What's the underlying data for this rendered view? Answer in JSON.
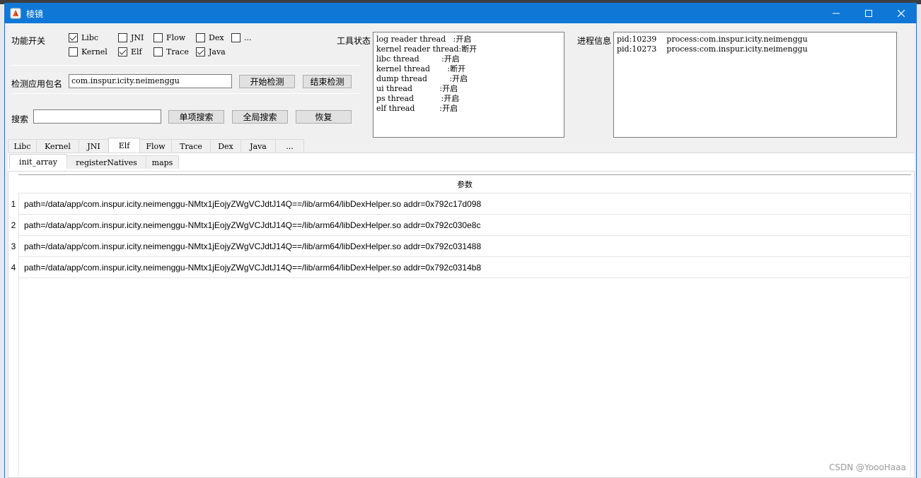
{
  "window": {
    "title": "棱镜",
    "controls": {
      "minimize": "minimize-icon",
      "maximize": "maximize-icon",
      "close": "close-icon"
    },
    "title_bar_color": "#0f78d7"
  },
  "feature_switch": {
    "label": "功能开关",
    "checkboxes": [
      {
        "label": "Libc",
        "checked": true
      },
      {
        "label": "JNI",
        "checked": false
      },
      {
        "label": "Flow",
        "checked": false
      },
      {
        "label": "Dex",
        "checked": false
      },
      {
        "label": "...",
        "checked": false
      },
      {
        "label": "Kernel",
        "checked": false
      },
      {
        "label": "Elf",
        "checked": true
      },
      {
        "label": "Trace",
        "checked": false
      },
      {
        "label": "Java",
        "checked": true
      }
    ]
  },
  "detect": {
    "label": "检测应用包名",
    "package_value": "com.inspur.icity.neimenggu",
    "start_button": "开始检测",
    "stop_button": "结束检测"
  },
  "search": {
    "label": "搜索",
    "value": "",
    "single_button": "单项搜索",
    "global_button": "全局搜索",
    "restore_button": "恢复"
  },
  "tool_status": {
    "label": "工具状态",
    "lines": [
      "log reader thread   :开启",
      "kernel reader thread:断开",
      "libc thread         :开启",
      "kernel thread       :断开",
      "dump thread         :开启",
      "ui thread           :开启",
      "ps thread           :开启",
      "elf thread          :开启"
    ]
  },
  "process_info": {
    "label": "进程信息",
    "lines": [
      "pid:10239    process:com.inspur.icity.neimenggu",
      "pid:10273    process:com.inspur.icity.neimenggu"
    ]
  },
  "main_tabs": {
    "items": [
      "Libc",
      "Kernel",
      "JNI",
      "Elf",
      "Flow",
      "Trace",
      "Dex",
      "Java",
      "..."
    ],
    "active": "Elf"
  },
  "sub_tabs": {
    "items": [
      "init_array",
      "registerNatives",
      "maps"
    ],
    "active": "init_array"
  },
  "table": {
    "column_header": "参数",
    "rows": [
      {
        "num": "1",
        "value": "path=/data/app/com.inspur.icity.neimenggu-NMtx1jEojyZWgVCJdtJ14Q==/lib/arm64/libDexHelper.so addr=0x792c17d098"
      },
      {
        "num": "2",
        "value": "path=/data/app/com.inspur.icity.neimenggu-NMtx1jEojyZWgVCJdtJ14Q==/lib/arm64/libDexHelper.so addr=0x792c030e8c"
      },
      {
        "num": "3",
        "value": "path=/data/app/com.inspur.icity.neimenggu-NMtx1jEojyZWgVCJdtJ14Q==/lib/arm64/libDexHelper.so addr=0x792c031488"
      },
      {
        "num": "4",
        "value": "path=/data/app/com.inspur.icity.neimenggu-NMtx1jEojyZWgVCJdtJ14Q==/lib/arm64/libDexHelper.so addr=0x792c0314b8"
      }
    ]
  },
  "watermark": "CSDN @YoooHaaa"
}
